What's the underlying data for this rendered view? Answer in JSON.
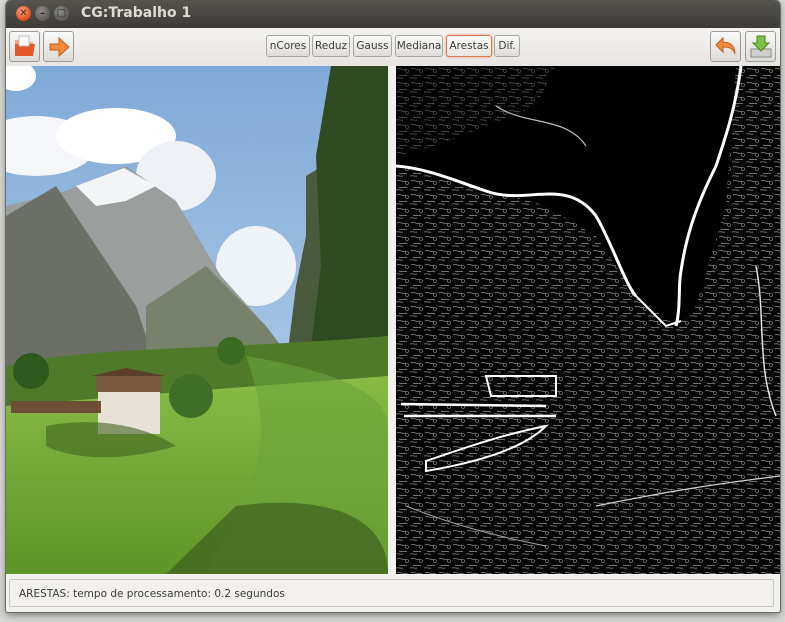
{
  "window": {
    "title": "CG:Trabalho 1"
  },
  "toolbar": {
    "left_buttons": [
      {
        "icon": "open-folder-icon"
      },
      {
        "icon": "arrow-right-icon"
      }
    ],
    "filters": [
      "nCores",
      "Reduz",
      "Gauss",
      "Mediana",
      "Arestas",
      "Dif."
    ],
    "active_filter": "Arestas",
    "right_buttons": [
      {
        "icon": "undo-arrow-icon"
      },
      {
        "icon": "save-download-icon"
      }
    ]
  },
  "status": {
    "text": "ARESTAS: tempo de processamento: 0.2 segundos"
  },
  "colors": {
    "accent": "#e07a4f",
    "titlebar": "#3c3b37",
    "close": "#df4a16"
  }
}
